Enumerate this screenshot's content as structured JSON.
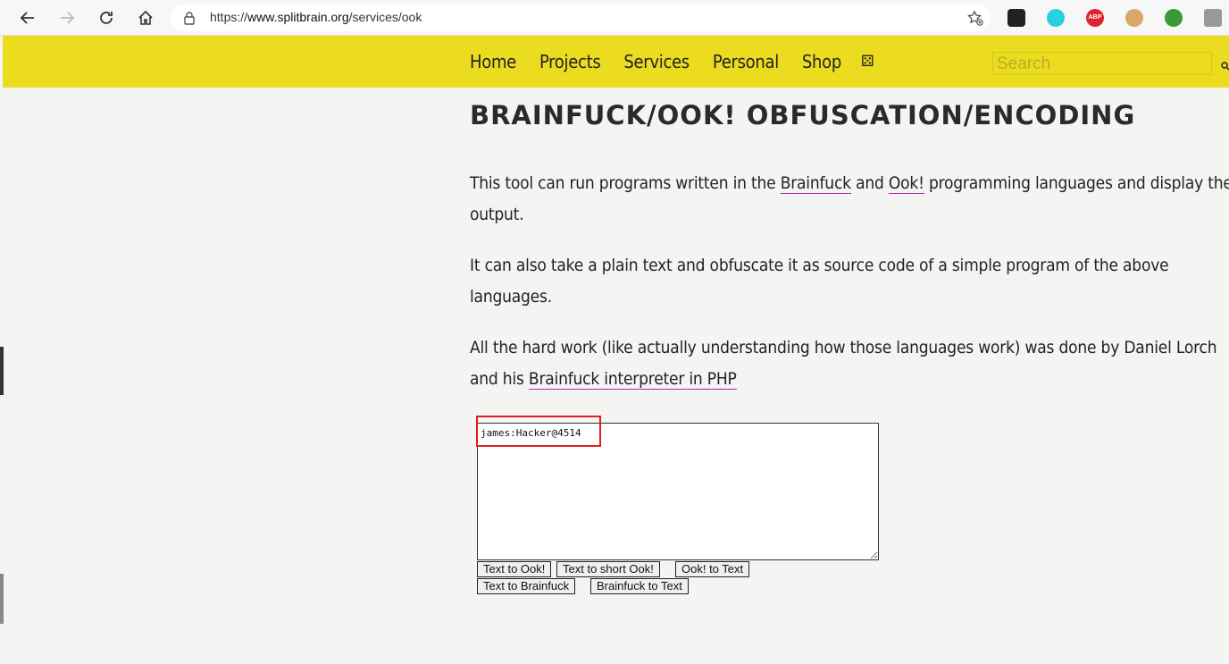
{
  "browser": {
    "url_prefix": "https://",
    "url_host": "www.splitbrain.org",
    "url_path": "/services/ook"
  },
  "site": {
    "menu": [
      "Home",
      "Projects",
      "Services",
      "Personal",
      "Shop"
    ],
    "dice_glyph": "⚄",
    "search_placeholder": "Search"
  },
  "main": {
    "title": "BRAINFUCK/OOK! OBFUSCATION/ENCODING",
    "p1": {
      "before": "This tool can run programs written in the ",
      "link1": "Brainfuck",
      "mid": " and ",
      "link2": "Ook!",
      "after": " programming languages and display the",
      "line2": "output."
    },
    "p2": {
      "line1": "It can also take a plain text and obfuscate it as source code of a simple program of the above",
      "line2": "languages."
    },
    "p3": {
      "line1": "All the hard work (like actually understanding how those languages work) was done by Daniel Lorch",
      "before": "and his ",
      "link": "Brainfuck interpreter in PHP"
    },
    "textarea_value": "james:Hacker@4514",
    "buttons": {
      "text_to_ook": "Text to Ook!",
      "text_to_short_ook": "Text to short Ook!",
      "ook_to_text": "Ook! to Text",
      "text_to_brainfuck": "Text to Brainfuck",
      "brainfuck_to_text": "Brainfuck to Text"
    }
  },
  "colors": {
    "header_yellow": "#ecdc20",
    "link_underline": "#b02ab0",
    "highlight_red": "#e01f1f"
  }
}
